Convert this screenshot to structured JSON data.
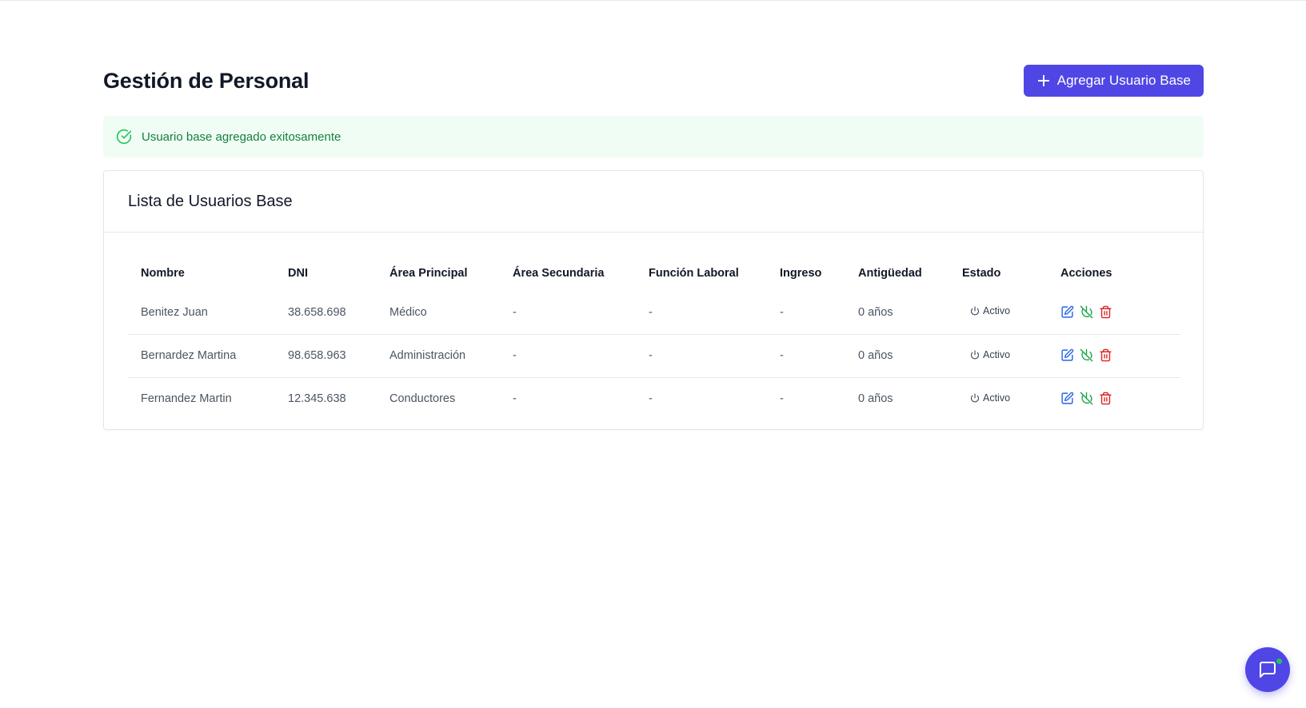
{
  "header": {
    "title": "Gestión de Personal",
    "add_button_label": "Agregar Usuario Base"
  },
  "alert": {
    "message": "Usuario base agregado exitosamente"
  },
  "card": {
    "title": "Lista de Usuarios Base"
  },
  "table": {
    "columns": [
      "Nombre",
      "DNI",
      "Área Principal",
      "Área Secundaria",
      "Función Laboral",
      "Ingreso",
      "Antigüedad",
      "Estado",
      "Acciones"
    ],
    "rows": [
      {
        "nombre": "Benitez Juan",
        "dni": "38.658.698",
        "area_principal": "Médico",
        "area_secundaria": "-",
        "funcion_laboral": "-",
        "ingreso": "-",
        "antiguedad": "0 años",
        "estado": "Activo"
      },
      {
        "nombre": "Bernardez Martina",
        "dni": "98.658.963",
        "area_principal": "Administración",
        "area_secundaria": "-",
        "funcion_laboral": "-",
        "ingreso": "-",
        "antiguedad": "0 años",
        "estado": "Activo"
      },
      {
        "nombre": "Fernandez Martin",
        "dni": "12.345.638",
        "area_principal": "Conductores",
        "area_secundaria": "-",
        "funcion_laboral": "-",
        "ingreso": "-",
        "antiguedad": "0 años",
        "estado": "Activo"
      }
    ]
  },
  "icons": {
    "add": "plus-icon",
    "alert": "check-circle-icon",
    "status": "power-icon",
    "edit": "edit-icon",
    "deactivate": "power-off-icon",
    "delete": "trash-icon",
    "chat": "chat-icon"
  },
  "colors": {
    "primary": "#4f46e5",
    "success_bg": "#f0fdf4",
    "success_text": "#15803d",
    "edit": "#2563eb",
    "deactivate": "#16a34a",
    "delete": "#dc2626",
    "online": "#22c55e"
  }
}
